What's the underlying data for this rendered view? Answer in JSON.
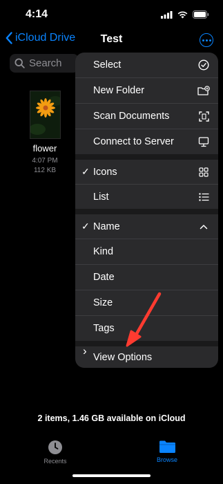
{
  "status_bar": {
    "time": "4:14"
  },
  "nav": {
    "back_label": "iCloud Drive",
    "title": "Test"
  },
  "search": {
    "placeholder": "Search"
  },
  "file": {
    "name": "flower",
    "time": "4:07 PM",
    "size": "112 KB"
  },
  "menu": {
    "select": "Select",
    "new_folder": "New Folder",
    "scan_documents": "Scan Documents",
    "connect_to_server": "Connect to Server",
    "icons": "Icons",
    "list": "List",
    "name": "Name",
    "kind": "Kind",
    "date": "Date",
    "size": "Size",
    "tags": "Tags",
    "view_options": "View Options",
    "checkmark": "✓",
    "chevron": "›"
  },
  "storage": "2 items, 1.46 GB available on iCloud",
  "tabs": {
    "recents": "Recents",
    "browse": "Browse"
  },
  "colors": {
    "accent": "#0a84ff",
    "annotation_arrow": "#ff3b30"
  },
  "icons": [
    "signal-icon",
    "wifi-icon",
    "battery-icon",
    "chevron-left-icon",
    "ellipsis-circle-icon",
    "search-icon",
    "checkmark-circle-icon",
    "folder-badge-plus-icon",
    "doc-viewfinder-icon",
    "display-icon",
    "grid-icon",
    "list-bullet-icon",
    "chevron-up-icon",
    "chevron-right-icon",
    "clock-icon",
    "folder-icon"
  ]
}
